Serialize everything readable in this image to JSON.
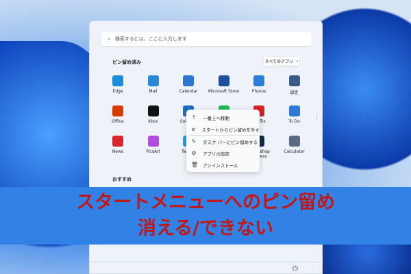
{
  "search": {
    "placeholder": "検索するには、ここに入力します"
  },
  "pinned": {
    "title": "ピン留め済み",
    "all_apps": "すべてのアプリ",
    "all_apps_chevron": "›"
  },
  "apps": [
    {
      "label": "Edge",
      "color": "#1f8bd8"
    },
    {
      "label": "Mail",
      "color": "#2a8ad8"
    },
    {
      "label": "Calendar",
      "color": "#2c76d2"
    },
    {
      "label": "Microsoft Store",
      "color": "#1d4f9a"
    },
    {
      "label": "Photos",
      "color": "#2f7ed6"
    },
    {
      "label": "設定",
      "color": "#3a5a8a"
    },
    {
      "label": "Office",
      "color": "#d83b01"
    },
    {
      "label": "Xbox",
      "color": "#111111"
    },
    {
      "label": "Solitaire",
      "color": "#1a6fc0"
    },
    {
      "label": "Spotify",
      "color": "#1db954"
    },
    {
      "label": "Netflix",
      "color": "#d81f26"
    },
    {
      "label": "To Do",
      "color": "#2f78d6"
    },
    {
      "label": "News",
      "color": "#d8262a"
    },
    {
      "label": "PicsArt",
      "color": "#b24be0"
    },
    {
      "label": "Twitter",
      "color": "#1da1f2"
    },
    {
      "label": "",
      "color": "#eef2f9"
    },
    {
      "label": "Photoshop Express",
      "color": "#0c2a48"
    },
    {
      "label": "Calculator",
      "color": "#5a6a80"
    }
  ],
  "recommended": {
    "title": "おすすめ"
  },
  "context_menu": [
    {
      "icon": "↑",
      "label": "一番上へ移動"
    },
    {
      "icon": "⌀",
      "label": "スタートからピン留めを外す"
    },
    {
      "icon": "✎",
      "label": "タスク バーにピン留めする"
    },
    {
      "icon": "⚙",
      "label": "アプリの設定"
    },
    {
      "icon": "🗑",
      "label": "アンインストール"
    }
  ],
  "banner": {
    "line1": "スタートメニューへのピン留め",
    "line2": "消える/できない"
  },
  "power_icon": "⏻"
}
